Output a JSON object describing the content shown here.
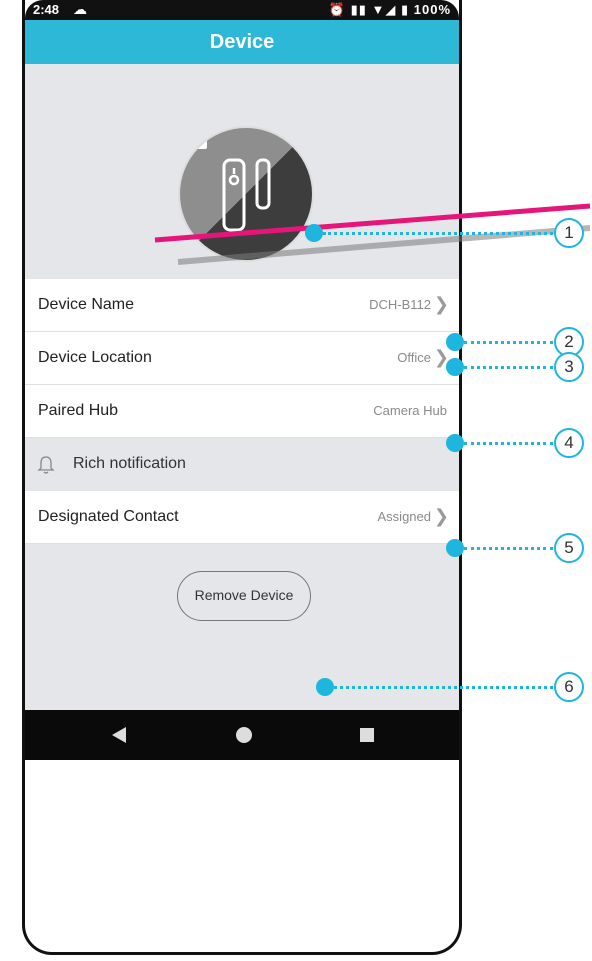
{
  "status_bar": {
    "time": "2:48",
    "battery": "100%",
    "icons": "⏰ ▮▮ ▼◢ ▮"
  },
  "header": {
    "title": "Device"
  },
  "rows": [
    {
      "label": "Device Name",
      "value": "DCH-B112",
      "chevron": true
    },
    {
      "label": "Device Location",
      "value": "Office",
      "chevron": true
    },
    {
      "label": "Paired Hub",
      "value": "Camera Hub",
      "chevron": false
    },
    {
      "label": "Rich notification",
      "icon": "bell-icon"
    },
    {
      "label": "Designated Contact",
      "value": "Assigned",
      "chevron": true
    }
  ],
  "remove_button": {
    "label": "Remove Device"
  },
  "callouts": [
    "1",
    "2",
    "3",
    "4",
    "5",
    "6"
  ],
  "colors": {
    "header": "#2cb8d6",
    "callout": "#1eb5de",
    "pointer": "#e5157a",
    "background": "#e4e6e9"
  }
}
